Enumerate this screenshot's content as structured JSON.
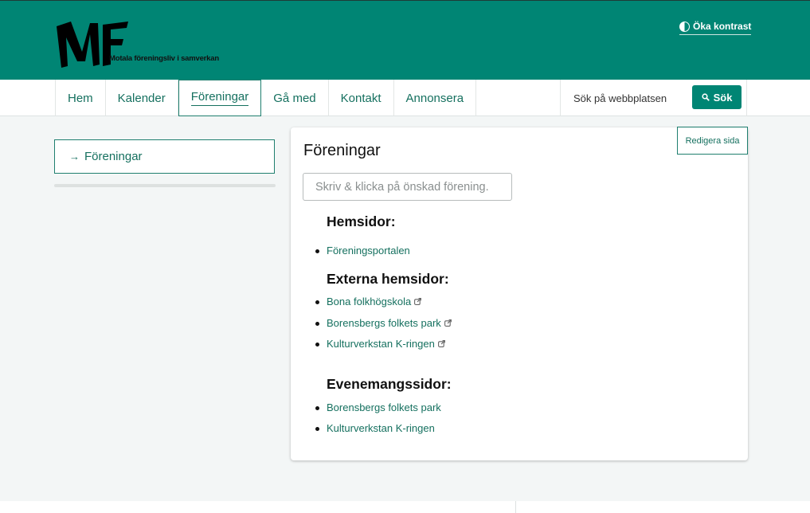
{
  "header": {
    "logo_text": "MF",
    "logo_tagline": "Motala föreningsliv i samverkan",
    "contrast_label": "Öka kontrast",
    "contrast_icon": "contrast-icon"
  },
  "nav": {
    "items": [
      {
        "label": "Hem"
      },
      {
        "label": "Kalender"
      },
      {
        "label": "Föreningar",
        "active": true
      },
      {
        "label": "Gå med"
      },
      {
        "label": "Kontakt"
      },
      {
        "label": "Annonsera"
      }
    ],
    "search_placeholder": "Sök på webbplatsen",
    "search_button": "Sök",
    "search_icon": "search-icon"
  },
  "sidebar": {
    "link_label": "Föreningar",
    "arrow": "→"
  },
  "content": {
    "edit_button": "Redigera sida",
    "title": "Föreningar",
    "filter_placeholder": "Skriv & klicka på önskad förening.",
    "sections": [
      {
        "heading": "Hemsidor:",
        "links": [
          "Föreningsportalen"
        ]
      },
      {
        "heading": "Externa hemsidor:",
        "links": [
          "Bona folkhögskola",
          "Borensbergs folkets park",
          "Kulturverkstan K-ringen"
        ]
      },
      {
        "heading": "Evenemangssidor:",
        "links": [
          "Borensbergs folkets park",
          "Kulturverkstan K-ringen"
        ]
      }
    ]
  },
  "colors": {
    "brand": "#008574",
    "link": "#15705f",
    "background": "#f3f6f6"
  }
}
